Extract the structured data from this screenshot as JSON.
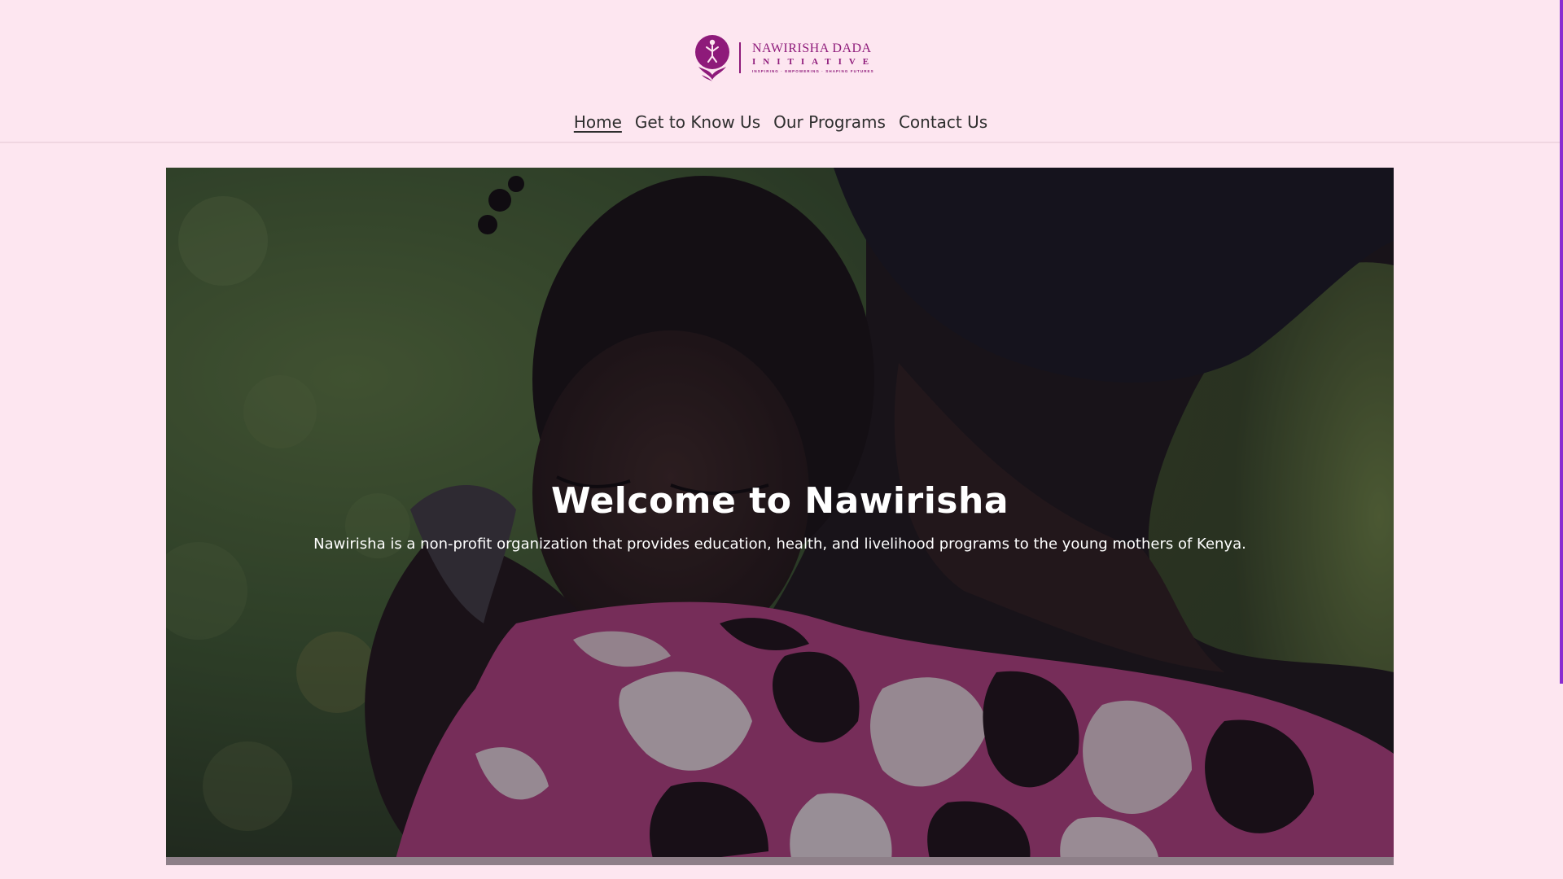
{
  "header": {
    "logo": {
      "name": "NAWIRISHA DADA",
      "sub": "INITIATIVE",
      "tagline": "INSPIRING · EMPOWERING · SHAPING FUTURES",
      "brand_color": "#8e1a7a"
    },
    "nav": [
      {
        "label": "Home",
        "active": true
      },
      {
        "label": "Get to Know Us",
        "active": false
      },
      {
        "label": "Our Programs",
        "active": false
      },
      {
        "label": "Contact Us",
        "active": false
      }
    ]
  },
  "hero": {
    "title": "Welcome to Nawirisha",
    "subtitle": "Nawirisha is a non-profit organization that provides education, health, and livelihood programs to the young mothers of Kenya.",
    "image_icon": "mother-and-child-photo"
  },
  "colors": {
    "page_background": "#fde6f0",
    "scrollbar": "#8a2cd0"
  }
}
